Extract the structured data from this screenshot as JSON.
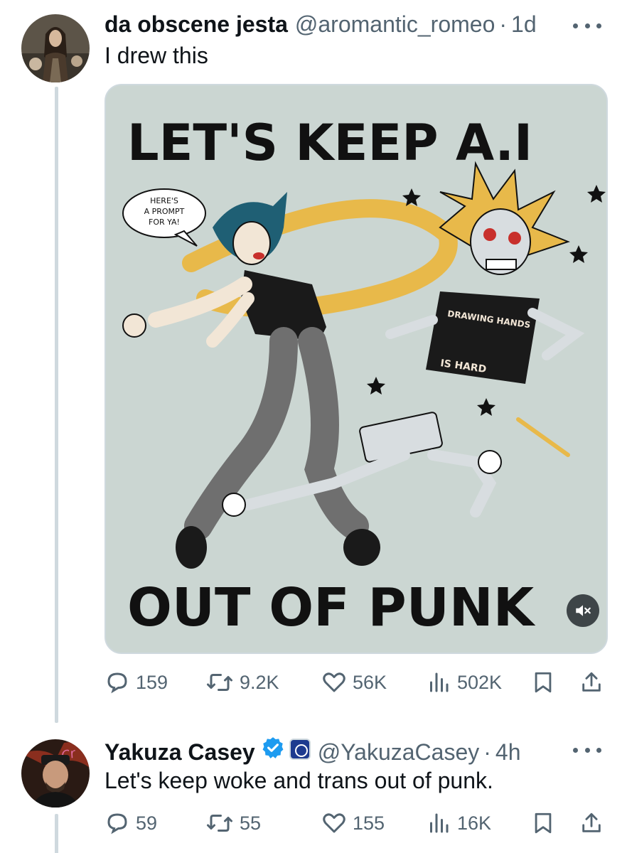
{
  "tweets": [
    {
      "display_name": "da obscene jesta",
      "handle": "@aromantic_romeo",
      "separator": "·",
      "time": "1d",
      "text": "I drew this",
      "media": {
        "title_top": "LET'S KEEP A.I",
        "title_bottom": "OUT OF PUNK",
        "speech_bubble": [
          "HERE'S",
          "A PROMPT",
          "FOR YA!"
        ],
        "shirt_top": "DRAWING HANDS",
        "shirt_bottom": "IS HARD",
        "background_color": "#cbd6d2"
      },
      "stats": {
        "replies": "159",
        "reposts": "9.2K",
        "likes": "56K",
        "views": "502K"
      }
    },
    {
      "display_name": "Yakuza Casey",
      "handle": "@YakuzaCasey",
      "separator": "·",
      "time": "4h",
      "text": "Let's keep woke and trans out of punk.",
      "stats": {
        "replies": "59",
        "reposts": "55",
        "likes": "155",
        "views": "16K"
      }
    }
  ],
  "colors": {
    "text": "#0f1419",
    "secondary": "#536471",
    "verified": "#1d9bf0",
    "border": "#cfd9de"
  }
}
